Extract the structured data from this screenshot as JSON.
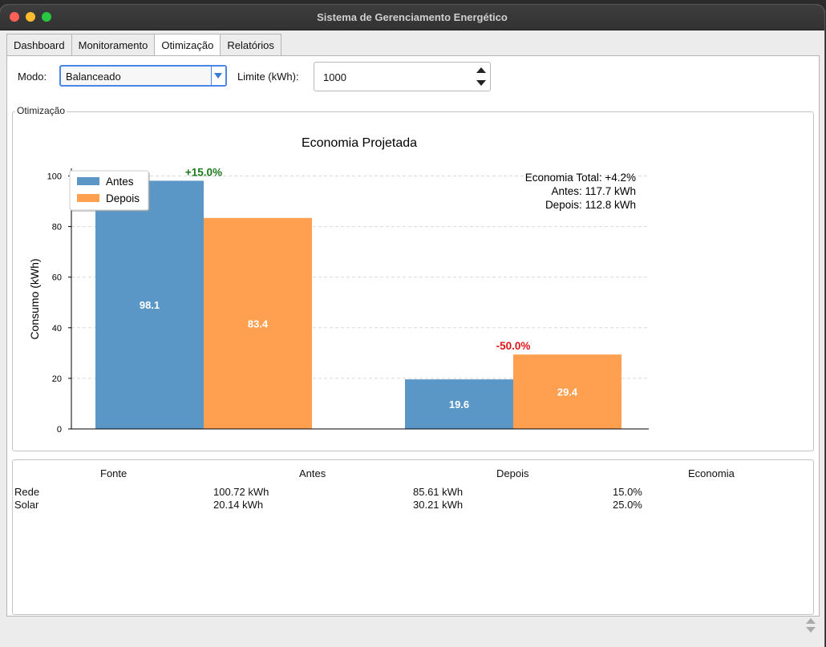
{
  "window": {
    "title": "Sistema de Gerenciamento Energético"
  },
  "tabs": [
    {
      "label": "Dashboard"
    },
    {
      "label": "Monitoramento"
    },
    {
      "label": "Otimização"
    },
    {
      "label": "Relatórios"
    }
  ],
  "controls": {
    "mode_label": "Modo:",
    "mode_value": "Balanceado",
    "limit_label": "Limite (kWh):",
    "limit_value": "1000"
  },
  "group": {
    "title": "Otimização"
  },
  "chart_data": {
    "type": "bar",
    "title": "Economia Projetada",
    "ylabel": "Consumo (kWh)",
    "xlabel": "",
    "ylim": [
      0,
      103
    ],
    "yticks": [
      0,
      20,
      40,
      60,
      80,
      100
    ],
    "grid": "y-dashed",
    "legend_position": "top-left",
    "series": [
      {
        "name": "Antes",
        "color": "#5b97c6",
        "values": [
          98.1,
          19.6
        ],
        "labels": [
          "98.1",
          "19.6"
        ]
      },
      {
        "name": "Depois",
        "color": "#ff9f50",
        "values": [
          83.4,
          29.4
        ],
        "labels": [
          "83.4",
          "29.4"
        ]
      }
    ],
    "change_labels": [
      {
        "text": "+15.0%",
        "color": "#1a7a1a"
      },
      {
        "text": "-50.0%",
        "color": "#e0161a"
      }
    ],
    "summary": {
      "total": "Economia Total: +4.2%",
      "antes": "Antes: 117.7 kWh",
      "depois": "Depois: 112.8 kWh"
    }
  },
  "table": {
    "headers": [
      "Fonte",
      "Antes",
      "Depois",
      "Economia"
    ],
    "rows": [
      [
        "Rede",
        "100.72 kWh",
        "85.61 kWh",
        "15.0%"
      ],
      [
        "Solar",
        "20.14 kWh",
        "30.21 kWh",
        "25.0%"
      ]
    ]
  }
}
